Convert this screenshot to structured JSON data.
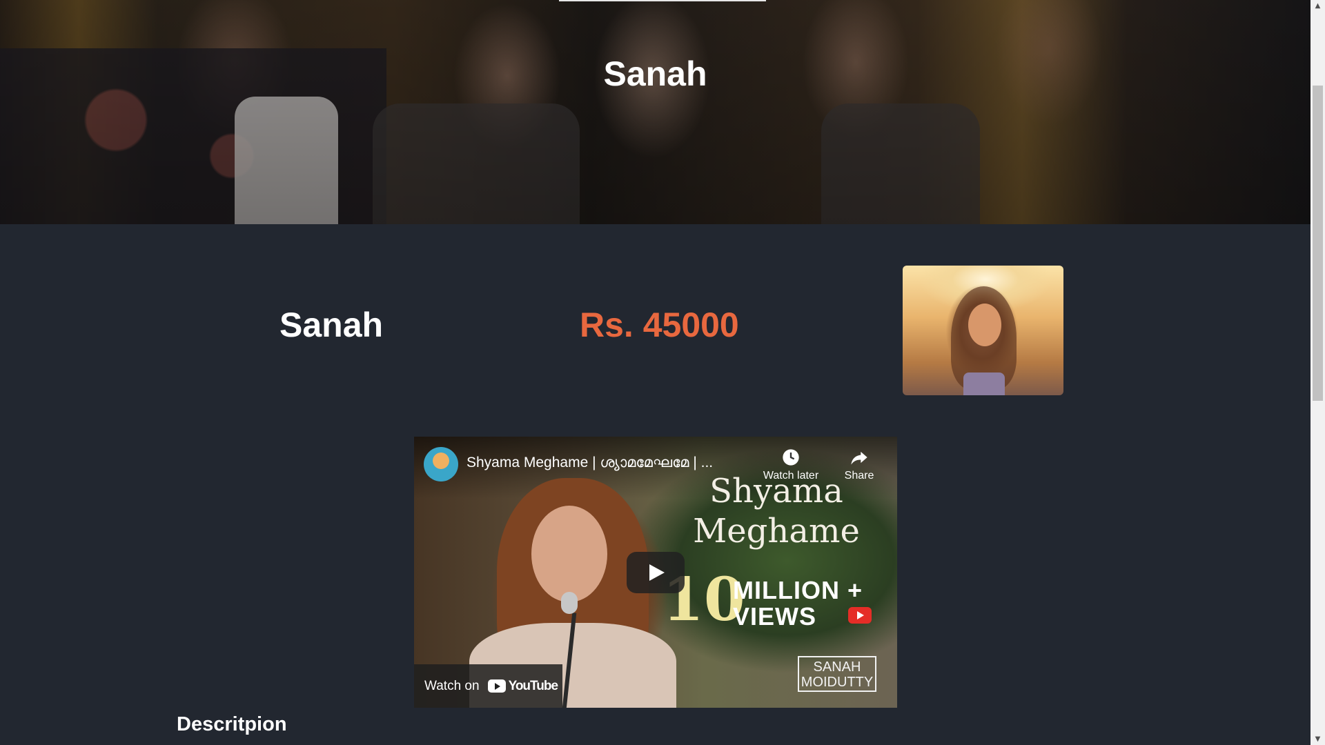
{
  "hero": {
    "title": "Sanah"
  },
  "product": {
    "name": "Sanah",
    "price": "Rs. 45000"
  },
  "video": {
    "title": "Shyama Meghame | ശ്യാമമേഘമേ | ...",
    "watch_later_label": "Watch later",
    "share_label": "Share",
    "thumbnail_title_line1": "Shyama",
    "thumbnail_title_line2": "Meghame",
    "thumbnail_number": "10",
    "thumbnail_million": "MILLION +",
    "thumbnail_views": "VIEWS",
    "watermark_line1": "SANAH",
    "watermark_line2": "MOIDUTTY",
    "watch_on_label": "Watch on",
    "youtube_logo_text": "YouTube"
  },
  "description": {
    "heading": "Descritpion"
  },
  "colors": {
    "page_bg": "#222730",
    "price_accent": "#e8683f",
    "youtube_red": "#e52d27"
  },
  "icons": {
    "watch_later": "clock-icon",
    "share": "share-arrow-icon",
    "play": "play-icon",
    "youtube": "youtube-logo-icon"
  }
}
